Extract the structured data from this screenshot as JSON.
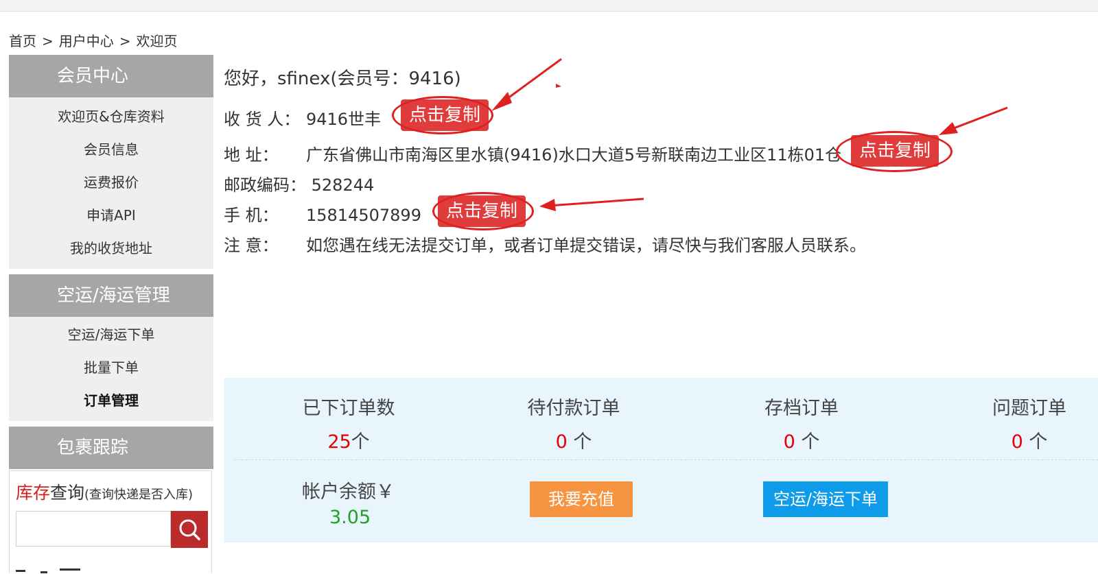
{
  "breadcrumb": {
    "home": "首页",
    "sep": ">",
    "user_center": "用户中心",
    "current": "欢迎页"
  },
  "sidebar": {
    "member_center": {
      "title": "会员中心",
      "items": [
        "欢迎页&仓库资料",
        "会员信息",
        "运费报价",
        "申请API",
        "我的收货地址"
      ]
    },
    "shipping": {
      "title": "空运/海运管理",
      "items": [
        "空运/海运下单",
        "批量下单",
        "订单管理"
      ],
      "active_index": 2
    },
    "tracking": {
      "title": "包裹跟踪"
    },
    "stock_query": {
      "title_red": "库存",
      "title_rest": "查询",
      "note": "(查询快递是否入库)",
      "input_value": "",
      "search_icon": "search-icon"
    }
  },
  "info": {
    "greeting": "您好，sfinex(会员号：9416)",
    "receiver_label": "收 货 人：",
    "receiver_value": "9416世丰",
    "address_label": "地      址：",
    "address_value": "广东省佛山市南海区里水镇(9416)水口大道5号新联南边工业区11栋01仓",
    "postcode_label": "邮政编码：",
    "postcode_value": "528244",
    "mobile_label": "手      机：",
    "mobile_value": "15814507899",
    "note_label": "注      意：",
    "note_value": "如您遇在线无法提交订单，或者订单提交错误，请尽快与我们客服人员联系。",
    "copy_label": "点击复制"
  },
  "stats": {
    "placed": {
      "title": "已下订单数",
      "value": "25",
      "unit": "个"
    },
    "unpaid": {
      "title": "待付款订单",
      "value": "0",
      "unit": " 个"
    },
    "archived": {
      "title": "存档订单",
      "value": "0",
      "unit": " 个"
    },
    "problem": {
      "title": "问题订单",
      "value": "0",
      "unit": " 个"
    },
    "balance_label": "帐户余额￥",
    "balance_value": "3.05",
    "recharge_button": "我要充值",
    "order_button": "空运/海运下单"
  },
  "colors": {
    "accent_red": "#e03c3c",
    "orange": "#f79441",
    "blue": "#0e9bea",
    "green": "#1fa31f",
    "sidebar_head": "#a6a6a6"
  }
}
